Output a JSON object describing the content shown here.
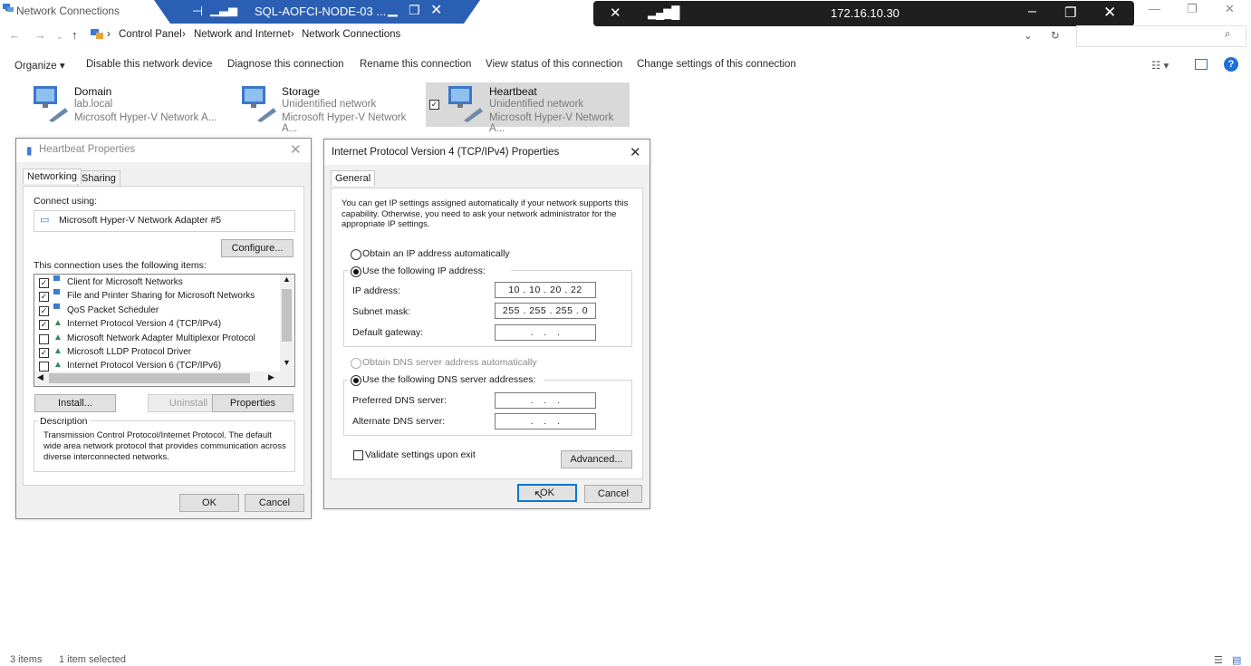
{
  "window": {
    "title": "Network Connections",
    "controls": [
      "—",
      "❐",
      "✕"
    ]
  },
  "rdp_bar": {
    "session_name": "SQL-AOFCI-NODE-03 ...",
    "ip": "172.16.10.30"
  },
  "address_bar": {
    "crumbs": [
      "Control Panel",
      "Network and Internet",
      "Network Connections"
    ]
  },
  "command_bar": {
    "organize": "Organize ▾",
    "disable": "Disable this network device",
    "diagnose": "Diagnose this connection",
    "rename": "Rename this connection",
    "view_status": "View status of this connection",
    "change_settings": "Change settings of this connection"
  },
  "connections": [
    {
      "name": "Domain",
      "status": "lab.local",
      "adapter": "Microsoft Hyper-V Network A..."
    },
    {
      "name": "Storage",
      "status": "Unidentified network",
      "adapter": "Microsoft Hyper-V Network A..."
    },
    {
      "name": "Heartbeat",
      "status": "Unidentified network",
      "adapter": "Microsoft Hyper-V Network A..."
    }
  ],
  "props_dialog": {
    "title": "Heartbeat Properties",
    "tabs": [
      "Networking",
      "Sharing"
    ],
    "connect_using_label": "Connect using:",
    "adapter": "Microsoft Hyper-V Network Adapter #5",
    "configure": "Configure...",
    "items_label": "This connection uses the following items:",
    "items": [
      {
        "label": "Client for Microsoft Networks",
        "checked": true
      },
      {
        "label": "File and Printer Sharing for Microsoft Networks",
        "checked": true
      },
      {
        "label": "QoS Packet Scheduler",
        "checked": true
      },
      {
        "label": "Internet Protocol Version 4 (TCP/IPv4)",
        "checked": true
      },
      {
        "label": "Microsoft Network Adapter Multiplexor Protocol",
        "checked": false
      },
      {
        "label": "Microsoft LLDP Protocol Driver",
        "checked": true
      },
      {
        "label": "Internet Protocol Version 6 (TCP/IPv6)",
        "checked": false
      }
    ],
    "install": "Install...",
    "uninstall": "Uninstall",
    "properties": "Properties",
    "description_label": "Description",
    "description": "Transmission Control Protocol/Internet Protocol. The default wide area network protocol that provides communication across diverse interconnected networks.",
    "ok": "OK",
    "cancel": "Cancel"
  },
  "ipv4_dialog": {
    "title": "Internet Protocol Version 4 (TCP/IPv4) Properties",
    "tab": "General",
    "intro": "You can get IP settings assigned automatically if your network supports this capability. Otherwise, you need to ask your network administrator for the appropriate IP settings.",
    "obtain_ip": "Obtain an IP address automatically",
    "use_ip": "Use the following IP address:",
    "ip_label": "IP address:",
    "ip_value": "10 . 10 . 20 . 22",
    "subnet_label": "Subnet mask:",
    "subnet_value": "255 . 255 . 255 . 0",
    "gateway_label": "Default gateway:",
    "gateway_value": ". . .",
    "obtain_dns": "Obtain DNS server address automatically",
    "use_dns": "Use the following DNS server addresses:",
    "pref_dns_label": "Preferred DNS server:",
    "pref_dns_value": ". . .",
    "alt_dns_label": "Alternate DNS server:",
    "alt_dns_value": ". . .",
    "validate": "Validate settings upon exit",
    "advanced": "Advanced...",
    "ok": "OK",
    "cancel": "Cancel"
  },
  "status_bar": {
    "items": "3 items",
    "selected": "1 item selected"
  },
  "colors": {
    "rdp_blue": "#2b5fb4",
    "rdp_black": "#1f1f1f",
    "selection": "#d9d9d9",
    "focus_blue": "#0078d7"
  }
}
